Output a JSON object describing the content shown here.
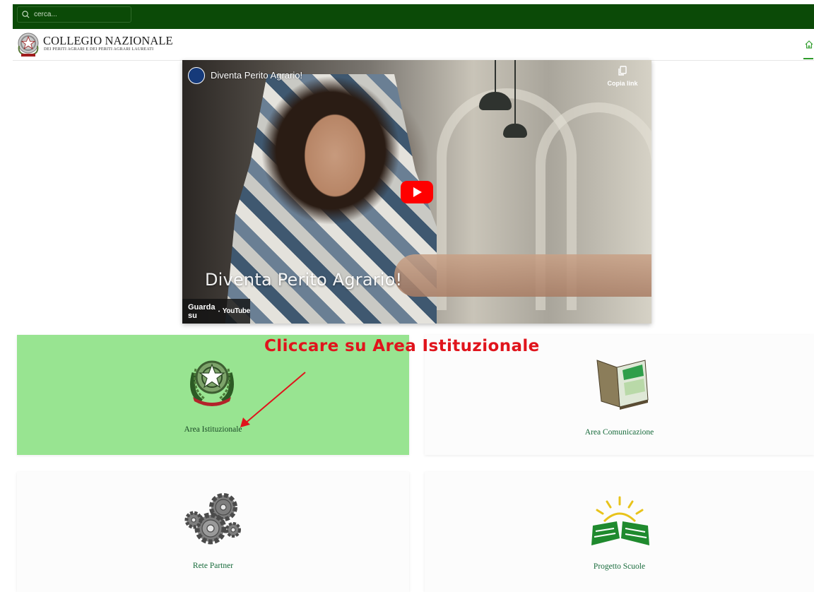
{
  "search": {
    "placeholder": "cerca..."
  },
  "header": {
    "org_name": "COLLEGIO NAZIONALE",
    "org_subtitle": "DEI PERITI AGRARI E DEI PERITI AGRARI LAUREATI",
    "home_icon": "home-icon"
  },
  "video": {
    "title": "Diventa Perito Agrario!",
    "overlay_title": "Diventa Perito Agrario!",
    "copy_link_label": "Copia link",
    "watch_on_label": "Guarda su",
    "youtube_brand": "YouTube",
    "play_icon": "play-icon"
  },
  "annotation": {
    "text": "Cliccare su Area  Istituzionale",
    "color": "#e0141c"
  },
  "tiles": [
    {
      "label": "Area Istituzionale",
      "icon": "emblem-italia-icon",
      "highlight": "#98e491"
    },
    {
      "label": "Area Comunicazione",
      "icon": "open-book-icon"
    },
    {
      "label": "Rete Partner",
      "icon": "gears-icon"
    },
    {
      "label": "Progetto Scuole",
      "icon": "sun-book-icon"
    }
  ],
  "colors": {
    "topbar": "#0b4a07",
    "accent": "#2e9b2a",
    "tile_label": "#166a3a"
  }
}
